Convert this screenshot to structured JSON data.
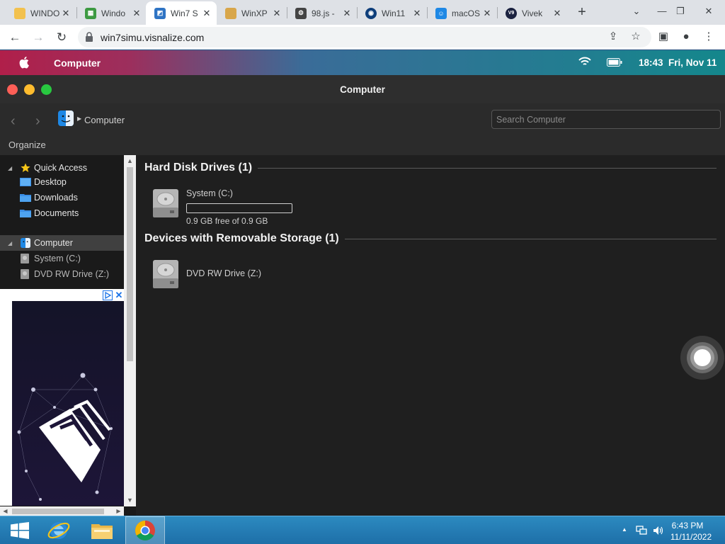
{
  "browser": {
    "tabs": [
      {
        "title": "WINDO",
        "favicon": "folder-icon",
        "favicon_color": "#f2c14e"
      },
      {
        "title": "Windo",
        "favicon": "grid-icon",
        "favicon_color": "#3d9a42"
      },
      {
        "title": "Win7 S",
        "favicon": "win7-icon",
        "favicon_color": "#2f74c4",
        "active": true
      },
      {
        "title": "WinXP",
        "favicon": "xp-icon",
        "favicon_color": "#d8a64a"
      },
      {
        "title": "98.js -",
        "favicon": "gear-icon",
        "favicon_color": "#444444"
      },
      {
        "title": "Win11",
        "favicon": "win11-icon",
        "favicon_color": "#0e3e7a"
      },
      {
        "title": "macOS",
        "favicon": "finder-icon",
        "favicon_color": "#1e88e5"
      },
      {
        "title": "Vivek",
        "favicon": "v9-icon",
        "favicon_color": "#1b2240"
      }
    ],
    "url": "win7simu.visnalize.com"
  },
  "menubar": {
    "title": "Computer",
    "clock": "18:43",
    "date": "Fri, Nov 11"
  },
  "window": {
    "title": "Computer",
    "breadcrumb": "Computer",
    "search_placeholder": "Search Computer",
    "organize": "Organize"
  },
  "sidebar": {
    "items": [
      {
        "label": "Quick Access",
        "icon": "star-icon"
      },
      {
        "label": "Desktop",
        "icon": "desktop-icon"
      },
      {
        "label": "Downloads",
        "icon": "folder-icon"
      },
      {
        "label": "Documents",
        "icon": "folder-icon"
      },
      {
        "label": "Computer",
        "icon": "finder-icon"
      },
      {
        "label": "System (C:)",
        "icon": "drive-icon"
      },
      {
        "label": "DVD RW Drive (Z:)",
        "icon": "drive-icon"
      }
    ]
  },
  "content": {
    "hard_disk_header": "Hard Disk Drives (1)",
    "removable_header": "Devices with Removable Storage (1)",
    "system_drive": {
      "name": "System (C:)",
      "free_text": "0.9 GB free of 0.9 GB",
      "used_fraction": 0.0
    },
    "dvd_drive": {
      "name": "DVD RW Drive (Z:)"
    }
  },
  "taskbar": {
    "time": "6:43 PM",
    "date": "11/11/2022"
  }
}
